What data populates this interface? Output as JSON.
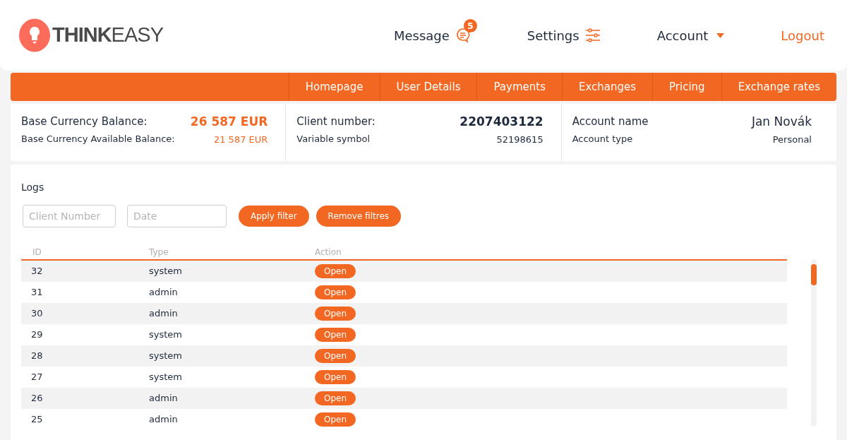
{
  "logo": "**THINK**EASY",
  "top_nav": [
    {
      "kind": "message",
      "label": "Message",
      "badge": "5"
    },
    {
      "kind": "settings",
      "label": "Settings"
    },
    {
      "kind": "account",
      "label": "Account"
    },
    {
      "kind": "logout",
      "label": "Logout"
    }
  ],
  "tabs": [
    {
      "label": "Homepage",
      "selected": false
    },
    {
      "label": "User Details",
      "selected": false
    },
    {
      "label": "Payments",
      "selected": false
    },
    {
      "label": "Exchanges",
      "selected": false
    },
    {
      "label": "Pricing",
      "selected": false
    },
    {
      "label": "Exchange rates",
      "selected": false
    }
  ],
  "summary": [
    {
      "kind": "balance",
      "label": "Base Currency Balance:",
      "value": "26 587 EUR",
      "sublabel": "Base Currency Available Balance:",
      "subvalue": "21 587 EUR"
    },
    {
      "kind": "client",
      "label": "Client number:",
      "value": "2207403122",
      "sublabel": "Variable symbol",
      "subvalue": "52198615"
    },
    {
      "kind": "account",
      "label": "Account name",
      "value": "Jan Novák",
      "sublabel": "Account type",
      "subvalue": "Personal"
    }
  ],
  "logs": {
    "title": "Logs",
    "filters": [
      {
        "placeholder": "Client Number"
      },
      {
        "placeholder": "Date"
      }
    ],
    "buttons": [
      "Apply filter",
      "Remove filtres"
    ],
    "columns": [
      "ID",
      "Type",
      "Action"
    ],
    "rows": [
      {
        "id": "32",
        "type": "system",
        "action": "Open"
      },
      {
        "id": "31",
        "type": "admin",
        "action": "Open"
      },
      {
        "id": "30",
        "type": "admin",
        "action": "Open"
      },
      {
        "id": "29",
        "type": "system",
        "action": "Open"
      },
      {
        "id": "28",
        "type": "system",
        "action": "Open"
      },
      {
        "id": "27",
        "type": "system",
        "action": "Open"
      },
      {
        "id": "26",
        "type": "admin",
        "action": "Open"
      },
      {
        "id": "25",
        "type": "admin",
        "action": "Open"
      }
    ]
  }
}
